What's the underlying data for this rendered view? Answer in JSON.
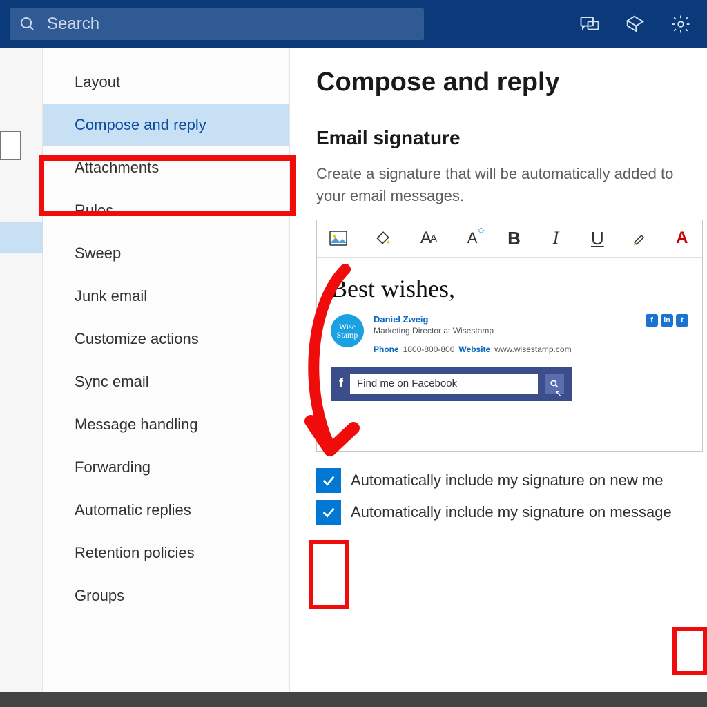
{
  "topbar": {
    "search_placeholder": "Search"
  },
  "nav": {
    "items": [
      "Layout",
      "Compose and reply",
      "Attachments",
      "Rules",
      "Sweep",
      "Junk email",
      "Customize actions",
      "Sync email",
      "Message handling",
      "Forwarding",
      "Automatic replies",
      "Retention policies",
      "Groups"
    ],
    "selected_index": 1
  },
  "content": {
    "title": "Compose and reply",
    "section_heading": "Email signature",
    "description": "Create a signature that will be automatically added to your email messages.",
    "toolbar": {
      "bold": "B",
      "italic": "I",
      "underline": "U",
      "fontcolor": "A"
    },
    "signature": {
      "greeting": "Best wishes,",
      "name": "Daniel Zweig",
      "title": "Marketing Director at Wisestamp",
      "phone_label": "Phone",
      "phone": "1800-800-800",
      "website_label": "Website",
      "website": "www.wisestamp.com",
      "avatar_text": "Wise Stamp",
      "fb_label": "Find me on Facebook"
    },
    "checkboxes": {
      "opt1": "Automatically include my signature on new me",
      "opt2": "Automatically include my signature on message"
    }
  }
}
